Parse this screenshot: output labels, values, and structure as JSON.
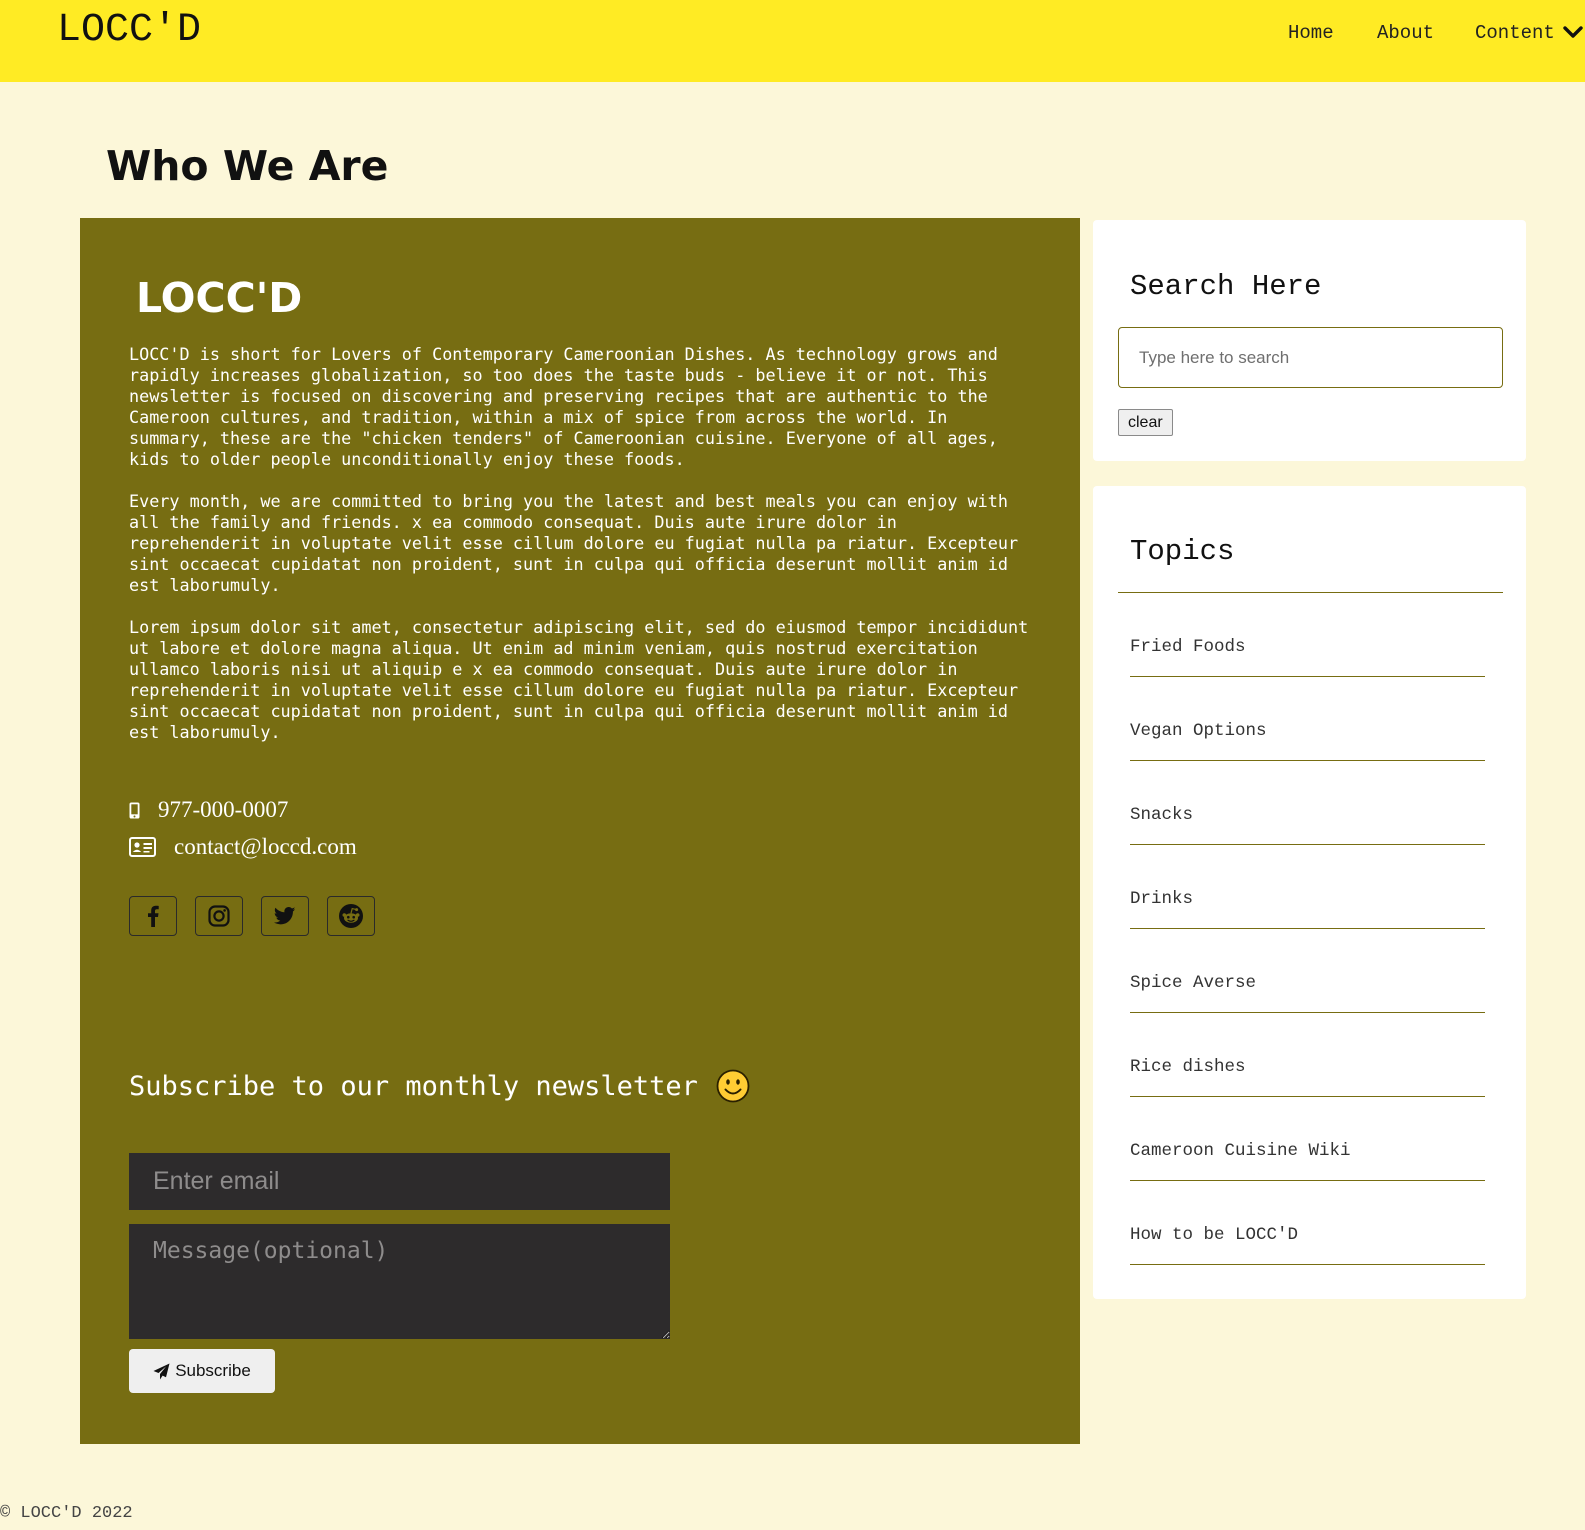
{
  "header": {
    "brand": "LOCC'D",
    "nav": {
      "home": "Home",
      "about": "About",
      "content": "Content"
    }
  },
  "page_title": "Who We Are",
  "about_panel": {
    "brand": "LOCC'D",
    "paragraphs": [
      "LOCC'D is short for Lovers of Contemporary Cameroonian Dishes. As technology grows and rapidly increases globalization, so too does the taste buds - believe it or not. This newsletter is focused on discovering and preserving recipes that are authentic to the Cameroon cultures, and tradition, within a mix of spice from across the world. In summary, these are the \"chicken tenders\" of Cameroonian cuisine. Everyone of all ages, kids to older people unconditionally enjoy these foods.",
      "Every month, we are committed to bring you the latest and best meals you can enjoy with all the family and friends. x ea commodo consequat. Duis aute irure dolor in reprehenderit in voluptate velit esse cillum dolore eu fugiat nulla pa riatur. Excepteur sint occaecat cupidatat non proident, sunt in culpa qui officia deserunt mollit anim id est laborumuly.",
      "Lorem ipsum dolor sit amet, consectetur adipiscing elit, sed do eiusmod tempor incididunt ut labore et dolore magna aliqua. Ut enim ad minim veniam, quis nostrud exercitation ullamco laboris nisi ut aliquip e x ea commodo consequat. Duis aute irure dolor in reprehenderit in voluptate velit esse cillum dolore eu fugiat nulla pa riatur. Excepteur sint occaecat cupidatat non proident, sunt in culpa qui officia deserunt mollit anim id est laborumuly."
    ],
    "phone": "977-000-0007",
    "email": "contact@loccd.com",
    "social_icons": [
      "facebook-icon",
      "instagram-icon",
      "twitter-icon",
      "reddit-icon"
    ]
  },
  "newsletter": {
    "title": "Subscribe to our monthly newsletter",
    "title_icon": "smiley-face-icon",
    "email_placeholder": "Enter email",
    "message_placeholder": "Message(optional)",
    "button_label": "Subscribe",
    "button_icon": "paper-plane-icon"
  },
  "search_card": {
    "title": "Search Here",
    "placeholder": "Type here to search",
    "value": "",
    "clear_label": "clear"
  },
  "topics_card": {
    "title": "Topics",
    "items": [
      "Fried Foods",
      "Vegan Options",
      "Snacks",
      "Drinks",
      "Spice Averse",
      "Rice dishes",
      "Cameroon Cuisine Wiki",
      "How to be LOCC'D"
    ]
  },
  "colors": {
    "header_bg": "#ffeb24",
    "page_bg": "#fcf7d9",
    "panel_bg": "#776d12",
    "input_bg": "#2d2b2c"
  },
  "footer": {
    "text": "© LOCC'D 2022"
  }
}
